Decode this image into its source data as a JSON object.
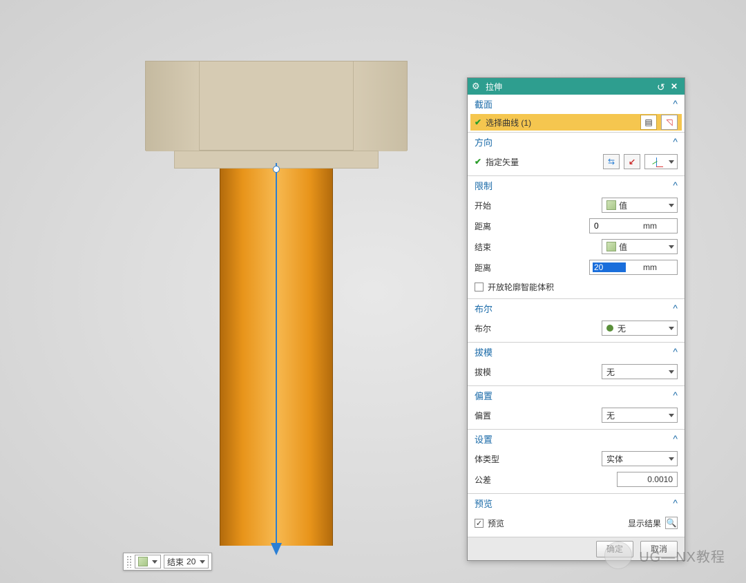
{
  "panel": {
    "title": "拉伸",
    "sections": {
      "section": {
        "title": "截面",
        "select_curve_label": "选择曲线 (1)"
      },
      "direction": {
        "title": "方向",
        "specify_vector": "指定矢量"
      },
      "limits": {
        "title": "限制",
        "start_label": "开始",
        "start_type": "值",
        "start_dist_label": "距离",
        "start_dist_value": "0",
        "start_dist_unit": "mm",
        "end_label": "结束",
        "end_type": "值",
        "end_dist_label": "距离",
        "end_dist_value": "20",
        "end_dist_unit": "mm",
        "open_profile_label": "开放轮廓智能体积"
      },
      "boolean": {
        "title": "布尔",
        "label": "布尔",
        "value": "无"
      },
      "draft": {
        "title": "拔模",
        "label": "拔模",
        "value": "无"
      },
      "offset": {
        "title": "偏置",
        "label": "偏置",
        "value": "无"
      },
      "settings": {
        "title": "设置",
        "body_type_label": "体类型",
        "body_type_value": "实体",
        "tolerance_label": "公差",
        "tolerance_value": "0.0010"
      },
      "preview": {
        "title": "预览",
        "checkbox_label": "预览",
        "show_result_label": "显示结果"
      }
    },
    "footer": {
      "ok": "确定",
      "cancel": "取消"
    }
  },
  "float_bar": {
    "end_label": "结束",
    "end_value": "20"
  },
  "watermark": "UG—NX教程"
}
